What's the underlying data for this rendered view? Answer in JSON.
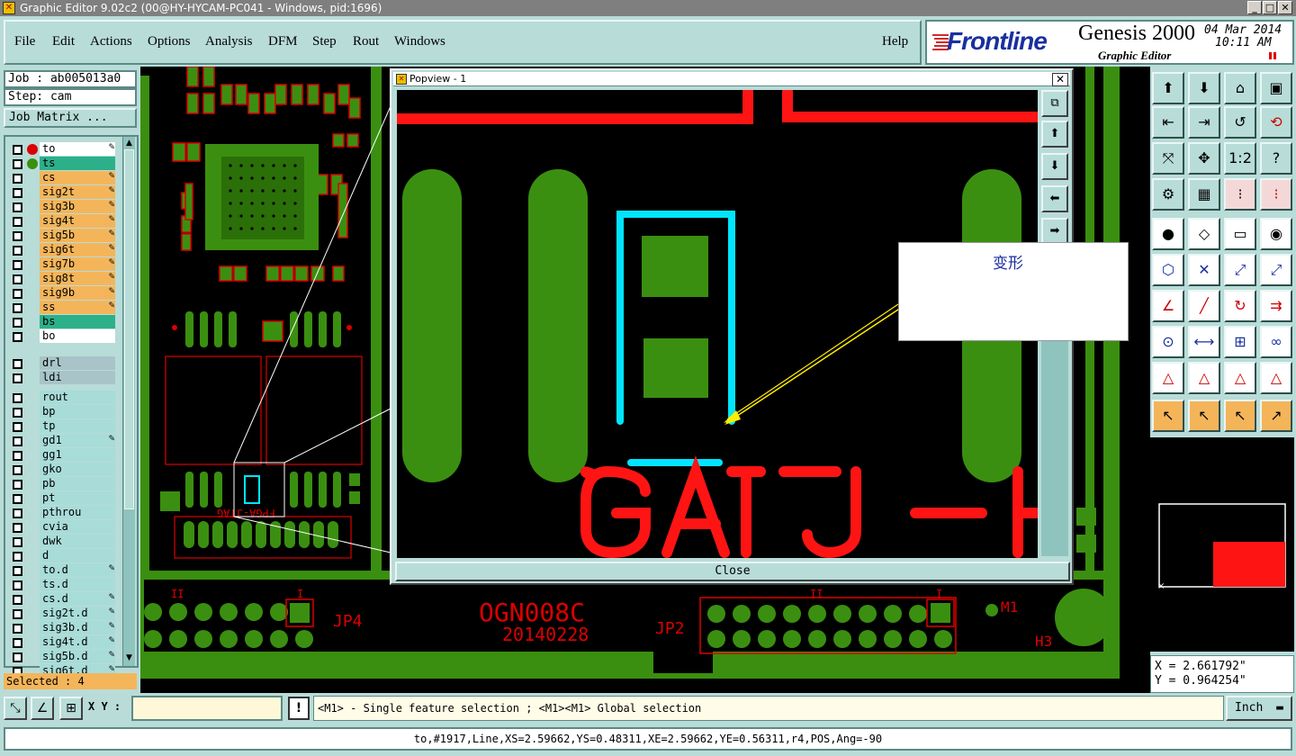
{
  "window": {
    "title": "Graphic Editor 9.02c2 (00@HY-HYCAM-PC041 - Windows, pid:1696)"
  },
  "menu": [
    "File",
    "Edit",
    "Actions",
    "Options",
    "Analysis",
    "DFM",
    "Step",
    "Rout",
    "Windows"
  ],
  "help": "Help",
  "logo": {
    "brand": "Frontline",
    "product": "Genesis 2000",
    "subtitle": "Graphic Editor",
    "date": "04 Mar 2014",
    "time": "10:11 AM"
  },
  "job": {
    "job_label": "Job : ab005013a0",
    "step_label": "Step: cam",
    "matrix_button": "Job Matrix ..."
  },
  "layers_board": [
    {
      "name": "to",
      "color": "#ffffff",
      "icon": "pencil"
    },
    {
      "name": "ts",
      "color": "#2bb08a",
      "icon": ""
    },
    {
      "name": "cs",
      "color": "#f4b55a",
      "icon": "pencil"
    },
    {
      "name": "sig2t",
      "color": "#f4b55a",
      "icon": "pencil"
    },
    {
      "name": "sig3b",
      "color": "#f4b55a",
      "icon": "pencil"
    },
    {
      "name": "sig4t",
      "color": "#f4b55a",
      "icon": "pencil"
    },
    {
      "name": "sig5b",
      "color": "#f4b55a",
      "icon": "pencil"
    },
    {
      "name": "sig6t",
      "color": "#f4b55a",
      "icon": "pencil"
    },
    {
      "name": "sig7b",
      "color": "#f4b55a",
      "icon": "pencil"
    },
    {
      "name": "sig8t",
      "color": "#f4b55a",
      "icon": "pencil"
    },
    {
      "name": "sig9b",
      "color": "#f4b55a",
      "icon": "pencil"
    },
    {
      "name": "ss",
      "color": "#f4b55a",
      "icon": "pencil"
    },
    {
      "name": "bs",
      "color": "#2bb08a",
      "icon": ""
    },
    {
      "name": "bo",
      "color": "#ffffff",
      "icon": ""
    }
  ],
  "layers_drill": [
    {
      "name": "drl",
      "color": "#a8c4c8"
    },
    {
      "name": "ldi",
      "color": "#a8c4c8"
    }
  ],
  "layers_misc": [
    {
      "name": "rout",
      "pen": false
    },
    {
      "name": "bp",
      "pen": false
    },
    {
      "name": "tp",
      "pen": false
    },
    {
      "name": "gd1",
      "pen": true
    },
    {
      "name": "gg1",
      "pen": false
    },
    {
      "name": "gko",
      "pen": false
    },
    {
      "name": "pb",
      "pen": false
    },
    {
      "name": "pt",
      "pen": false
    },
    {
      "name": "pthrou",
      "pen": false
    },
    {
      "name": "cvia",
      "pen": false
    },
    {
      "name": "dwk",
      "pen": false
    },
    {
      "name": "d",
      "pen": false
    },
    {
      "name": "to.d",
      "pen": true
    },
    {
      "name": "ts.d",
      "pen": false
    },
    {
      "name": "cs.d",
      "pen": true
    },
    {
      "name": "sig2t.d",
      "pen": true
    },
    {
      "name": "sig3b.d",
      "pen": true
    },
    {
      "name": "sig4t.d",
      "pen": true
    },
    {
      "name": "sig5b.d",
      "pen": true
    },
    {
      "name": "sig6t.d",
      "pen": true
    }
  ],
  "selected": "Selected : 4",
  "popview": {
    "title": "Popview - 1",
    "close_label": "Close"
  },
  "callout": "变形",
  "board_text": {
    "part": "OGN008C",
    "date": "20140228",
    "jp4": "JP4",
    "jp2": "JP2",
    "m1": "M1",
    "h3": "H3",
    "fpga": "FPGA-JTAG",
    "jtag": "JTAG"
  },
  "bottom": {
    "xy_label": "X Y :",
    "xy_value": "",
    "message": "<M1> - Single feature selection ; <M1><M1> Global selection",
    "units": "Inch"
  },
  "coords": {
    "x": "X = 2.661792\"",
    "y": "Y = 0.964254\""
  },
  "status": "to,#1917,Line,XS=2.59662,YS=0.48311,XE=2.59662,YE=0.56311,r4,POS,Ang=-90",
  "icons": {
    "row1": [
      "home-up-icon",
      "home-down-icon",
      "house-icon",
      "window-icon"
    ],
    "row2": [
      "pan-left-icon",
      "pan-right-icon",
      "zoom-back-icon",
      "redraw-icon"
    ],
    "row3": [
      "fit-icon",
      "center-icon",
      "scale-1-2-icon",
      "help-icon"
    ],
    "row4": [
      "measure-tool-icon",
      "grid-icon",
      "layer-colors-icon",
      "layer-colors-red-icon"
    ],
    "row5": [
      "add-pad-icon",
      "add-line-icon",
      "ruler-icon",
      "snap-icon"
    ],
    "row6": [
      "add-net-icon",
      "cross-icon",
      "route-icon",
      "route-red-icon"
    ],
    "row7": [
      "slope-icon",
      "diag-line-icon",
      "rotate-icon",
      "mirror-icon"
    ],
    "row8": [
      "select-node-icon",
      "split-icon",
      "measure-icon",
      "connect-icon"
    ],
    "row9": [
      "arc-tri-icon",
      "arc-tri-2-icon",
      "arc-tri-3-icon",
      "arc-tri-4-icon"
    ],
    "row10": [
      "select-pointer-icon",
      "select-box-icon",
      "select-pointer-2-icon",
      "select-route-icon"
    ]
  },
  "toolbar_bottom": [
    "select-rect-icon",
    "select-line-icon",
    "grid-snap-icon"
  ],
  "popview_buttons": [
    "zoom-in-pv-icon",
    "home-pv-icon",
    "down-pv-icon",
    "left-pv-icon",
    "right-pv-icon"
  ]
}
